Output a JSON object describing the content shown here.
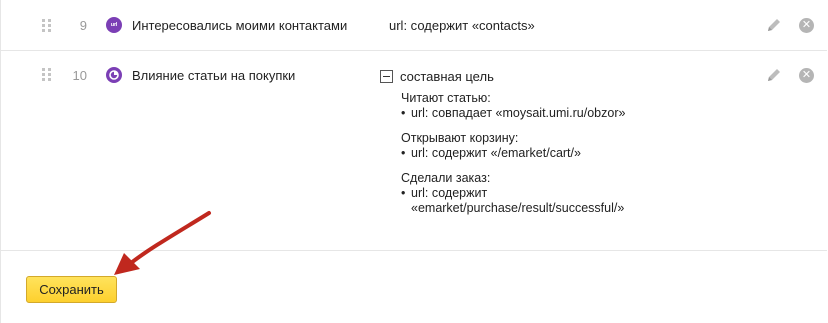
{
  "goals": [
    {
      "number": "9",
      "icon": "url-icon",
      "icon_text": "url",
      "name": "Интересовались моими контактами",
      "condition": "url: содержит «contacts»"
    },
    {
      "number": "10",
      "icon": "composite-goal-icon",
      "name": "Влияние статьи на покупки",
      "composite_label": "составная цель",
      "steps": [
        {
          "title": "Читают статью:",
          "condition": "url: совпадает «moysait.umi.ru/obzor»"
        },
        {
          "title": "Открывают корзину:",
          "condition": "url: содержит «/emarket/cart/»"
        },
        {
          "title": "Сделали заказ:",
          "condition_line1": "url: содержит",
          "condition_line2": "«emarket/purchase/result/successful/»"
        }
      ]
    }
  ],
  "save_label": "Сохранить",
  "colors": {
    "goal_icon": "#7b3fb5",
    "save_button": "#fdd02e",
    "annotation_arrow": "#c0281e"
  }
}
